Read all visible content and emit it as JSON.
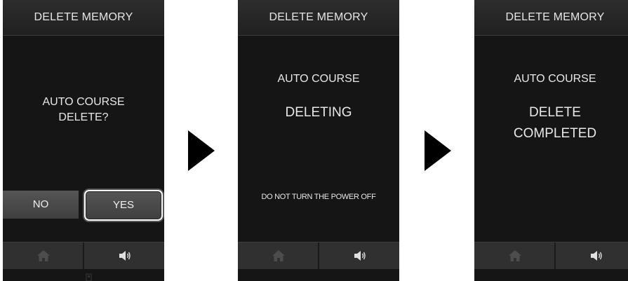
{
  "screens": [
    {
      "header": "DELETE MEMORY",
      "message_line1": "AUTO COURSE",
      "message_line2": "DELETE?",
      "buttons": {
        "no": "NO",
        "yes": "YES"
      },
      "nav": {
        "left_icon": "home-icon",
        "right_icon": "speaker-icon"
      }
    },
    {
      "header": "DELETE MEMORY",
      "title": "AUTO COURSE",
      "status": "DELETING",
      "warning": "DO NOT TURN THE POWER OFF",
      "nav": {
        "left_icon": "home-icon",
        "right_icon": "speaker-icon"
      }
    },
    {
      "header": "DELETE MEMORY",
      "title": "AUTO COURSE",
      "status_line1": "DELETE",
      "status_line2": "COMPLETED",
      "nav": {
        "left_icon": "home-icon",
        "right_icon": "speaker-icon"
      }
    }
  ],
  "colors": {
    "screen_bg": "#151515",
    "header_bg": "#2a2a2a",
    "button_bg": "#4a4a4a",
    "highlight_border": "#ffffff",
    "text": "#e8e8e8"
  }
}
